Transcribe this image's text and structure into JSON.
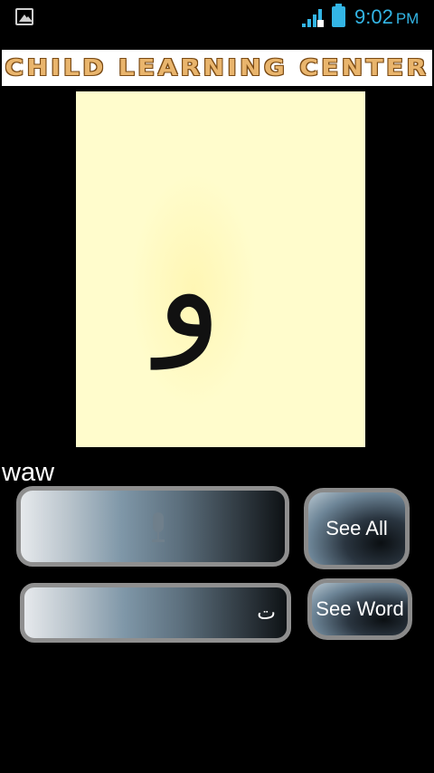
{
  "status_bar": {
    "time": "9:02",
    "ampm": "PM",
    "icons": [
      "gallery-notification-icon",
      "signal-icon",
      "battery-icon"
    ],
    "accent_color": "#33b5e5"
  },
  "banner": {
    "title": "CHILD LEARNING CENTER"
  },
  "letter": {
    "glyph": "و",
    "name": "waw"
  },
  "mic_button": {
    "icon": "microphone-icon"
  },
  "text_field": {
    "value": "ت"
  },
  "buttons": {
    "see_all": "See All",
    "see_word": "See Word"
  }
}
